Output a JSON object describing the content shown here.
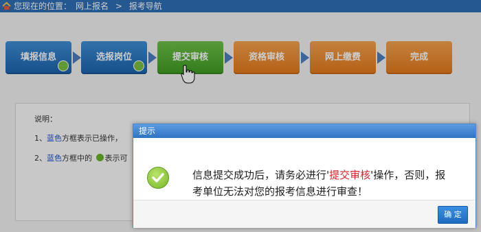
{
  "breadcrumb": {
    "prefix": "您现在的位置：",
    "item1": "网上报名",
    "separator": ">",
    "item2": "报考导航"
  },
  "steps": [
    {
      "label": "填报信息",
      "state": "done"
    },
    {
      "label": "选报岗位",
      "state": "done"
    },
    {
      "label": "提交审核",
      "state": "current"
    },
    {
      "label": "资格审核",
      "state": "pending"
    },
    {
      "label": "网上缴费",
      "state": "pending"
    },
    {
      "label": "完成",
      "state": "pending"
    }
  ],
  "notes": {
    "title": "说明：",
    "line1_num": "1、",
    "line1_color": "蓝色",
    "line1_rest": "方框表示已操作，",
    "line2_num": "2、",
    "line2_color": "蓝色",
    "line2_mid": "方框中的",
    "line2_rest": "表示可"
  },
  "dialog": {
    "title": "提示",
    "message_pre": "信息提交成功后，请务必进行'",
    "message_highlight": "提交审核",
    "message_post": "'操作，否则，报考单位无法对您的报考信息进行审查！",
    "ok_label": "确 定"
  },
  "colors": {
    "topbar": "#2f6fb6",
    "step_done": "#1c62ad",
    "step_current": "#3f9a21",
    "step_pending": "#e3781a",
    "highlight": "#e0202a"
  }
}
